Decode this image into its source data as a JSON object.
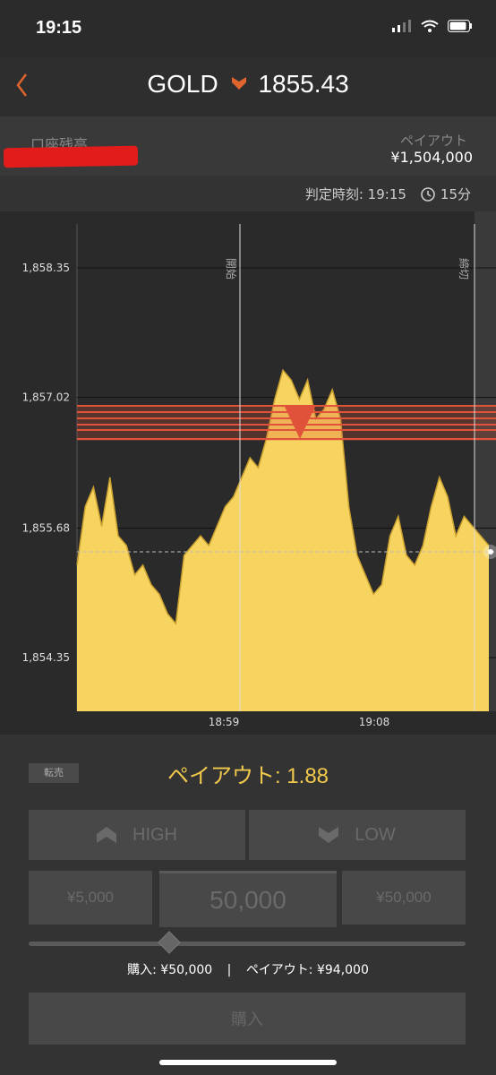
{
  "status": {
    "time": "19:15"
  },
  "header": {
    "back_icon": "chevron-left-icon",
    "symbol": "GOLD",
    "direction_icon": "down-arrow-icon",
    "price": "1855.43"
  },
  "account": {
    "label": "口座残高",
    "payout_label": "ペイアウト",
    "payout_value": "¥1,504,000"
  },
  "judge": {
    "label": "判定時刻:",
    "time": "19:15",
    "duration": "15分"
  },
  "chart_data": {
    "type": "area",
    "y_ticks": [
      "1,858.35",
      "1,857.02",
      "1,855.68",
      "1,854.35"
    ],
    "x_ticks": [
      "18:59",
      "19:08"
    ],
    "markers": {
      "start": "開始",
      "end": "締切"
    },
    "ylim": [
      1853.8,
      1858.8
    ],
    "values": [
      1855.3,
      1855.9,
      1856.1,
      1855.7,
      1856.2,
      1855.6,
      1855.5,
      1855.2,
      1855.3,
      1855.1,
      1855.0,
      1854.8,
      1854.7,
      1855.4,
      1855.5,
      1855.6,
      1855.5,
      1855.7,
      1855.9,
      1856.0,
      1856.2,
      1856.4,
      1856.3,
      1856.6,
      1857.0,
      1857.3,
      1857.2,
      1857.0,
      1857.2,
      1856.8,
      1856.9,
      1857.1,
      1856.8,
      1855.9,
      1855.4,
      1855.2,
      1855.0,
      1855.1,
      1855.6,
      1855.8,
      1855.4,
      1855.3,
      1855.5,
      1855.9,
      1856.2,
      1856.0,
      1855.6,
      1855.8,
      1855.7,
      1855.6,
      1855.5
    ]
  },
  "controls": {
    "tag": "転売",
    "payout_title": "ペイアウト: 1.88",
    "high": "HIGH",
    "low": "LOW",
    "amount_small": "¥5,000",
    "amount_value": "50,000",
    "amount_large": "¥50,000",
    "buy_summary": "購入: ¥50,000",
    "payout_summary": "ペイアウト: ¥94,000",
    "buy": "購入"
  }
}
